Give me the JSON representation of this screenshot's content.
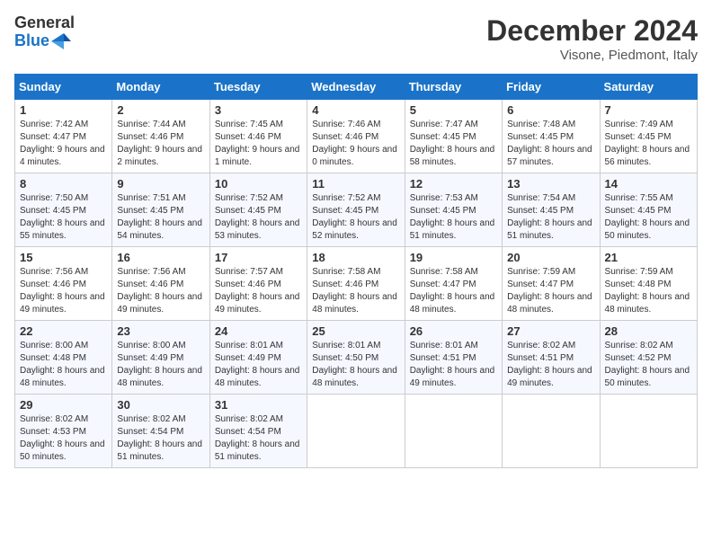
{
  "header": {
    "logo_line1": "General",
    "logo_line2": "Blue",
    "month": "December 2024",
    "location": "Visone, Piedmont, Italy"
  },
  "weekdays": [
    "Sunday",
    "Monday",
    "Tuesday",
    "Wednesday",
    "Thursday",
    "Friday",
    "Saturday"
  ],
  "weeks": [
    [
      {
        "day": "1",
        "sunrise": "Sunrise: 7:42 AM",
        "sunset": "Sunset: 4:47 PM",
        "daylight": "Daylight: 9 hours and 4 minutes."
      },
      {
        "day": "2",
        "sunrise": "Sunrise: 7:44 AM",
        "sunset": "Sunset: 4:46 PM",
        "daylight": "Daylight: 9 hours and 2 minutes."
      },
      {
        "day": "3",
        "sunrise": "Sunrise: 7:45 AM",
        "sunset": "Sunset: 4:46 PM",
        "daylight": "Daylight: 9 hours and 1 minute."
      },
      {
        "day": "4",
        "sunrise": "Sunrise: 7:46 AM",
        "sunset": "Sunset: 4:46 PM",
        "daylight": "Daylight: 9 hours and 0 minutes."
      },
      {
        "day": "5",
        "sunrise": "Sunrise: 7:47 AM",
        "sunset": "Sunset: 4:45 PM",
        "daylight": "Daylight: 8 hours and 58 minutes."
      },
      {
        "day": "6",
        "sunrise": "Sunrise: 7:48 AM",
        "sunset": "Sunset: 4:45 PM",
        "daylight": "Daylight: 8 hours and 57 minutes."
      },
      {
        "day": "7",
        "sunrise": "Sunrise: 7:49 AM",
        "sunset": "Sunset: 4:45 PM",
        "daylight": "Daylight: 8 hours and 56 minutes."
      }
    ],
    [
      {
        "day": "8",
        "sunrise": "Sunrise: 7:50 AM",
        "sunset": "Sunset: 4:45 PM",
        "daylight": "Daylight: 8 hours and 55 minutes."
      },
      {
        "day": "9",
        "sunrise": "Sunrise: 7:51 AM",
        "sunset": "Sunset: 4:45 PM",
        "daylight": "Daylight: 8 hours and 54 minutes."
      },
      {
        "day": "10",
        "sunrise": "Sunrise: 7:52 AM",
        "sunset": "Sunset: 4:45 PM",
        "daylight": "Daylight: 8 hours and 53 minutes."
      },
      {
        "day": "11",
        "sunrise": "Sunrise: 7:52 AM",
        "sunset": "Sunset: 4:45 PM",
        "daylight": "Daylight: 8 hours and 52 minutes."
      },
      {
        "day": "12",
        "sunrise": "Sunrise: 7:53 AM",
        "sunset": "Sunset: 4:45 PM",
        "daylight": "Daylight: 8 hours and 51 minutes."
      },
      {
        "day": "13",
        "sunrise": "Sunrise: 7:54 AM",
        "sunset": "Sunset: 4:45 PM",
        "daylight": "Daylight: 8 hours and 51 minutes."
      },
      {
        "day": "14",
        "sunrise": "Sunrise: 7:55 AM",
        "sunset": "Sunset: 4:45 PM",
        "daylight": "Daylight: 8 hours and 50 minutes."
      }
    ],
    [
      {
        "day": "15",
        "sunrise": "Sunrise: 7:56 AM",
        "sunset": "Sunset: 4:46 PM",
        "daylight": "Daylight: 8 hours and 49 minutes."
      },
      {
        "day": "16",
        "sunrise": "Sunrise: 7:56 AM",
        "sunset": "Sunset: 4:46 PM",
        "daylight": "Daylight: 8 hours and 49 minutes."
      },
      {
        "day": "17",
        "sunrise": "Sunrise: 7:57 AM",
        "sunset": "Sunset: 4:46 PM",
        "daylight": "Daylight: 8 hours and 49 minutes."
      },
      {
        "day": "18",
        "sunrise": "Sunrise: 7:58 AM",
        "sunset": "Sunset: 4:46 PM",
        "daylight": "Daylight: 8 hours and 48 minutes."
      },
      {
        "day": "19",
        "sunrise": "Sunrise: 7:58 AM",
        "sunset": "Sunset: 4:47 PM",
        "daylight": "Daylight: 8 hours and 48 minutes."
      },
      {
        "day": "20",
        "sunrise": "Sunrise: 7:59 AM",
        "sunset": "Sunset: 4:47 PM",
        "daylight": "Daylight: 8 hours and 48 minutes."
      },
      {
        "day": "21",
        "sunrise": "Sunrise: 7:59 AM",
        "sunset": "Sunset: 4:48 PM",
        "daylight": "Daylight: 8 hours and 48 minutes."
      }
    ],
    [
      {
        "day": "22",
        "sunrise": "Sunrise: 8:00 AM",
        "sunset": "Sunset: 4:48 PM",
        "daylight": "Daylight: 8 hours and 48 minutes."
      },
      {
        "day": "23",
        "sunrise": "Sunrise: 8:00 AM",
        "sunset": "Sunset: 4:49 PM",
        "daylight": "Daylight: 8 hours and 48 minutes."
      },
      {
        "day": "24",
        "sunrise": "Sunrise: 8:01 AM",
        "sunset": "Sunset: 4:49 PM",
        "daylight": "Daylight: 8 hours and 48 minutes."
      },
      {
        "day": "25",
        "sunrise": "Sunrise: 8:01 AM",
        "sunset": "Sunset: 4:50 PM",
        "daylight": "Daylight: 8 hours and 48 minutes."
      },
      {
        "day": "26",
        "sunrise": "Sunrise: 8:01 AM",
        "sunset": "Sunset: 4:51 PM",
        "daylight": "Daylight: 8 hours and 49 minutes."
      },
      {
        "day": "27",
        "sunrise": "Sunrise: 8:02 AM",
        "sunset": "Sunset: 4:51 PM",
        "daylight": "Daylight: 8 hours and 49 minutes."
      },
      {
        "day": "28",
        "sunrise": "Sunrise: 8:02 AM",
        "sunset": "Sunset: 4:52 PM",
        "daylight": "Daylight: 8 hours and 50 minutes."
      }
    ],
    [
      {
        "day": "29",
        "sunrise": "Sunrise: 8:02 AM",
        "sunset": "Sunset: 4:53 PM",
        "daylight": "Daylight: 8 hours and 50 minutes."
      },
      {
        "day": "30",
        "sunrise": "Sunrise: 8:02 AM",
        "sunset": "Sunset: 4:54 PM",
        "daylight": "Daylight: 8 hours and 51 minutes."
      },
      {
        "day": "31",
        "sunrise": "Sunrise: 8:02 AM",
        "sunset": "Sunset: 4:54 PM",
        "daylight": "Daylight: 8 hours and 51 minutes."
      },
      null,
      null,
      null,
      null
    ]
  ]
}
